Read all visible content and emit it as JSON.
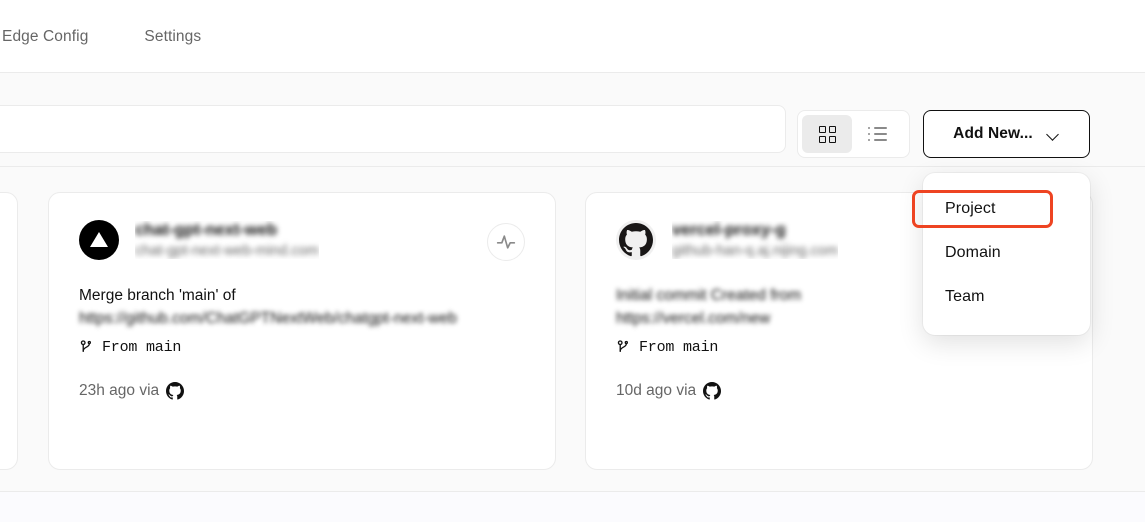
{
  "tabs": [
    {
      "label": "Edge Config",
      "active": false
    },
    {
      "label": "Settings",
      "active": false
    }
  ],
  "toolbar": {
    "search": {
      "value": "",
      "placeholder": ""
    },
    "view_toggle": {
      "grid_icon": "grid-view-icon",
      "list_icon": "list-view-icon",
      "selected": "grid"
    },
    "add_new": {
      "label": "Add New...",
      "chevron_icon": "chevron-down-icon"
    }
  },
  "dropdown": {
    "items": [
      {
        "label": "Project",
        "highlighted": true
      },
      {
        "label": "Domain",
        "highlighted": false
      },
      {
        "label": "Team",
        "highlighted": false
      }
    ],
    "highlight_color": "#ee4422"
  },
  "projects": [
    {
      "avatar_icon": "vercel-triangle-icon",
      "name": "chat-gpt-next-web",
      "domain": "chat-gpt-next-web-mind.com",
      "commit_line1": "Merge branch 'main' of",
      "commit_line2": "https://github.com/ChatGPTNextWeb/chatgpt-next-web",
      "branch_icon": "git-branch-icon",
      "branch": "From main",
      "time": "23h ago via",
      "source_icon": "github-icon",
      "activity_icon": "activity-pulse-icon"
    },
    {
      "avatar_icon": "github-icon",
      "name": "vercel-proxy-g",
      "domain": "github-han-q.aj.nijing.com",
      "commit_line1": "Initial commit Created from",
      "commit_line2": "https://vercel.com/new",
      "branch_icon": "git-branch-icon",
      "branch": "From main",
      "time": "10d ago via",
      "source_icon": "github-icon",
      "activity_icon": ""
    }
  ],
  "colors": {
    "page_bg": "#ffffff",
    "panel_bg": "#fafafa",
    "border": "#ebebeb",
    "text_primary": "#111111",
    "text_secondary": "#666666",
    "accent_annotation": "#ee4422"
  }
}
